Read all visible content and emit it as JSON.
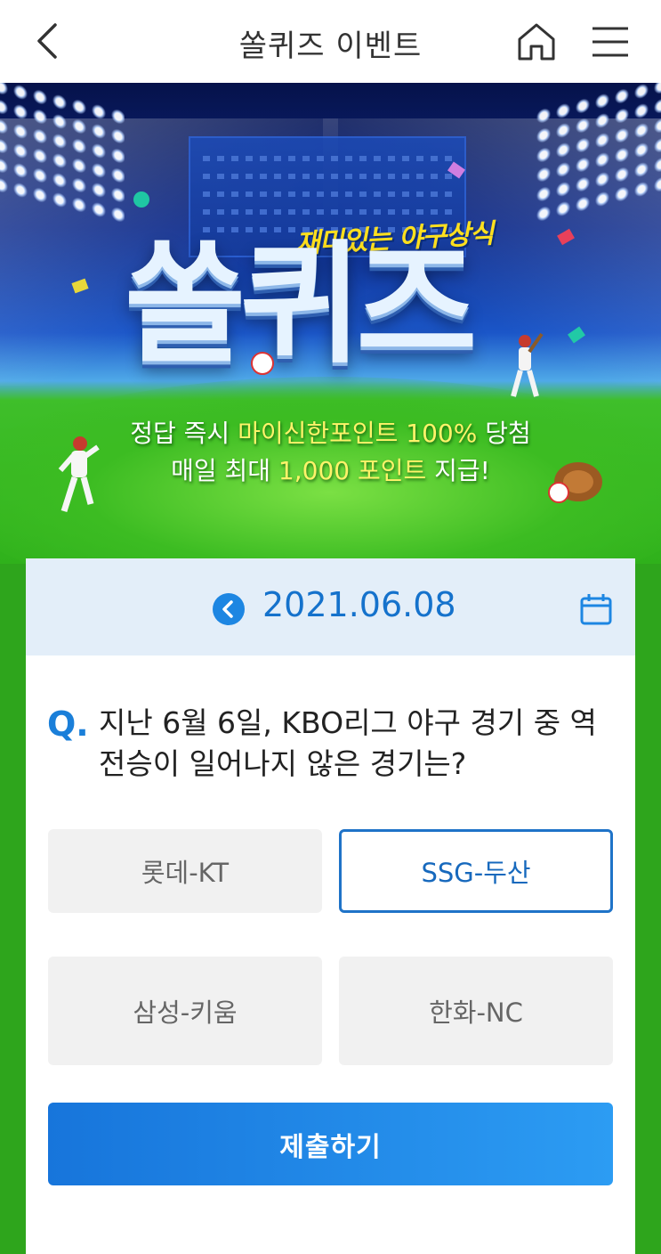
{
  "header": {
    "title": "쏠퀴즈 이벤트",
    "back_icon": "chevron-left-icon",
    "home_icon": "home-icon",
    "menu_icon": "hamburger-menu-icon"
  },
  "banner": {
    "tagline": "재미있는 야구상식",
    "logo_text": "쏠퀴즈",
    "line1_prefix": "정답 즉시 ",
    "line1_highlight": "마이신한포인트 100%",
    "line1_suffix": " 당첨",
    "line2_prefix": "매일 최대 ",
    "line2_highlight": "1,000 포인트",
    "line2_suffix": " 지급!"
  },
  "date_bar": {
    "prev_icon": "chevron-left-circle-icon",
    "date": "2021.06.08",
    "calendar_icon": "calendar-icon"
  },
  "question": {
    "marker": "Q.",
    "text": "지난 6월 6일, KBO리그 야구 경기 중 역전승이 일어나지 않은 경기는?"
  },
  "options": [
    {
      "label": "롯데-KT",
      "selected": false
    },
    {
      "label": "SSG-두산",
      "selected": true
    },
    {
      "label": "삼성-키움",
      "selected": false
    },
    {
      "label": "한화-NC",
      "selected": false
    }
  ],
  "submit_label": "제출하기",
  "colors": {
    "accent": "#1a7fd9",
    "selected_border": "#1f73c8",
    "date_bar_bg": "#e3eef9",
    "page_bg": "#2ea51c"
  }
}
